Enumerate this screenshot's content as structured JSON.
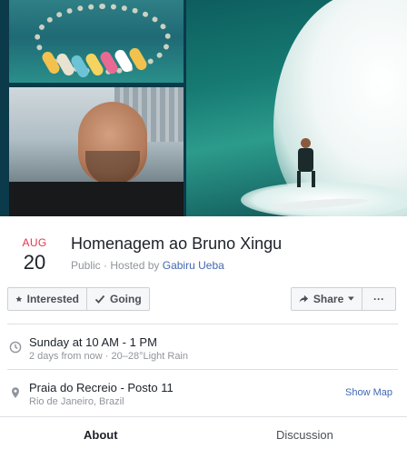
{
  "event": {
    "month": "AUG",
    "day": "20",
    "title": "Homenagem ao Bruno Xingu",
    "privacy": "Public",
    "hosted_by_prefix": "Hosted by",
    "host": "Gabiru Ueba"
  },
  "actions": {
    "interested_label": "Interested",
    "going_label": "Going",
    "share_label": "Share",
    "more_label": "···"
  },
  "details": {
    "time_main": "Sunday at 10 AM - 1 PM",
    "time_sub": "2 days from now · 20–28°Light Rain",
    "place_main": "Praia do Recreio - Posto 11",
    "place_sub": "Rio de Janeiro, Brazil",
    "show_map_label": "Show Map"
  },
  "tabs": {
    "about": "About",
    "discussion": "Discussion"
  },
  "colors": {
    "date_month": "#e4344b",
    "link": "#4267b2",
    "muted": "#90949c"
  },
  "icons": [
    "star-icon",
    "checkmark-icon",
    "share-arrow-icon",
    "caret-down-icon",
    "clock-icon",
    "location-pin-icon"
  ]
}
